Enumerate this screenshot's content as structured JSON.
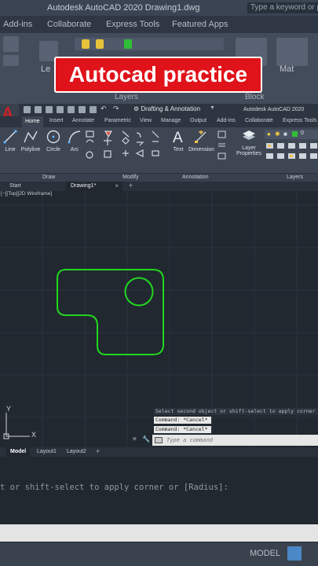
{
  "background": {
    "title": "Autodesk AutoCAD 2020   Drawing1.dwg",
    "search_placeholder": "Type a keyword or p",
    "tabs": [
      "Add-ins",
      "Collaborate",
      "Express Tools",
      "Featured Apps"
    ],
    "panel_labels": [
      "Layers",
      "Block"
    ],
    "big_labels": [
      "Le",
      "Mat"
    ],
    "command_echo": "t or shift-select to apply corner or [Radius]:",
    "status_text": "MODEL"
  },
  "banner": {
    "text": "Autocad practice"
  },
  "app": {
    "title": "Autodesk AutoCAD 2020",
    "logo_letter": "A",
    "workspace": "Drafting & Annotation",
    "ribbon_tabs": [
      "Home",
      "Insert",
      "Annotate",
      "Parametric",
      "View",
      "Manage",
      "Output",
      "Add-ins",
      "Collaborate",
      "Express Tools"
    ],
    "active_tab": "Home",
    "tools": {
      "line": "Line",
      "polyline": "Polyline",
      "circle": "Circle",
      "arc": "Arc",
      "text": "Text",
      "dimension": "Dimension",
      "layer_properties": "Layer Properties"
    },
    "layer_value": "0",
    "panels": [
      "Draw",
      "Modify",
      "Annotation",
      "Layers"
    ],
    "doc_tabs": [
      "Start",
      "Drawing1*"
    ],
    "viewport_label": "[−][Top][2D Wireframe]",
    "ucs": {
      "x": "X",
      "y": "Y"
    },
    "command_history": [
      "Select second object or shift-select to apply corner or [Radius]:",
      "Command: *Cancel*",
      "Command: *Cancel*"
    ],
    "command_placeholder": "Type a command",
    "layout_tabs": [
      "Model",
      "Layout1",
      "Layout2"
    ],
    "colors": {
      "shape": "#22d61e",
      "ucs": "#d6d6d6",
      "canvas": "#212830",
      "logo": "#d31f26"
    }
  }
}
